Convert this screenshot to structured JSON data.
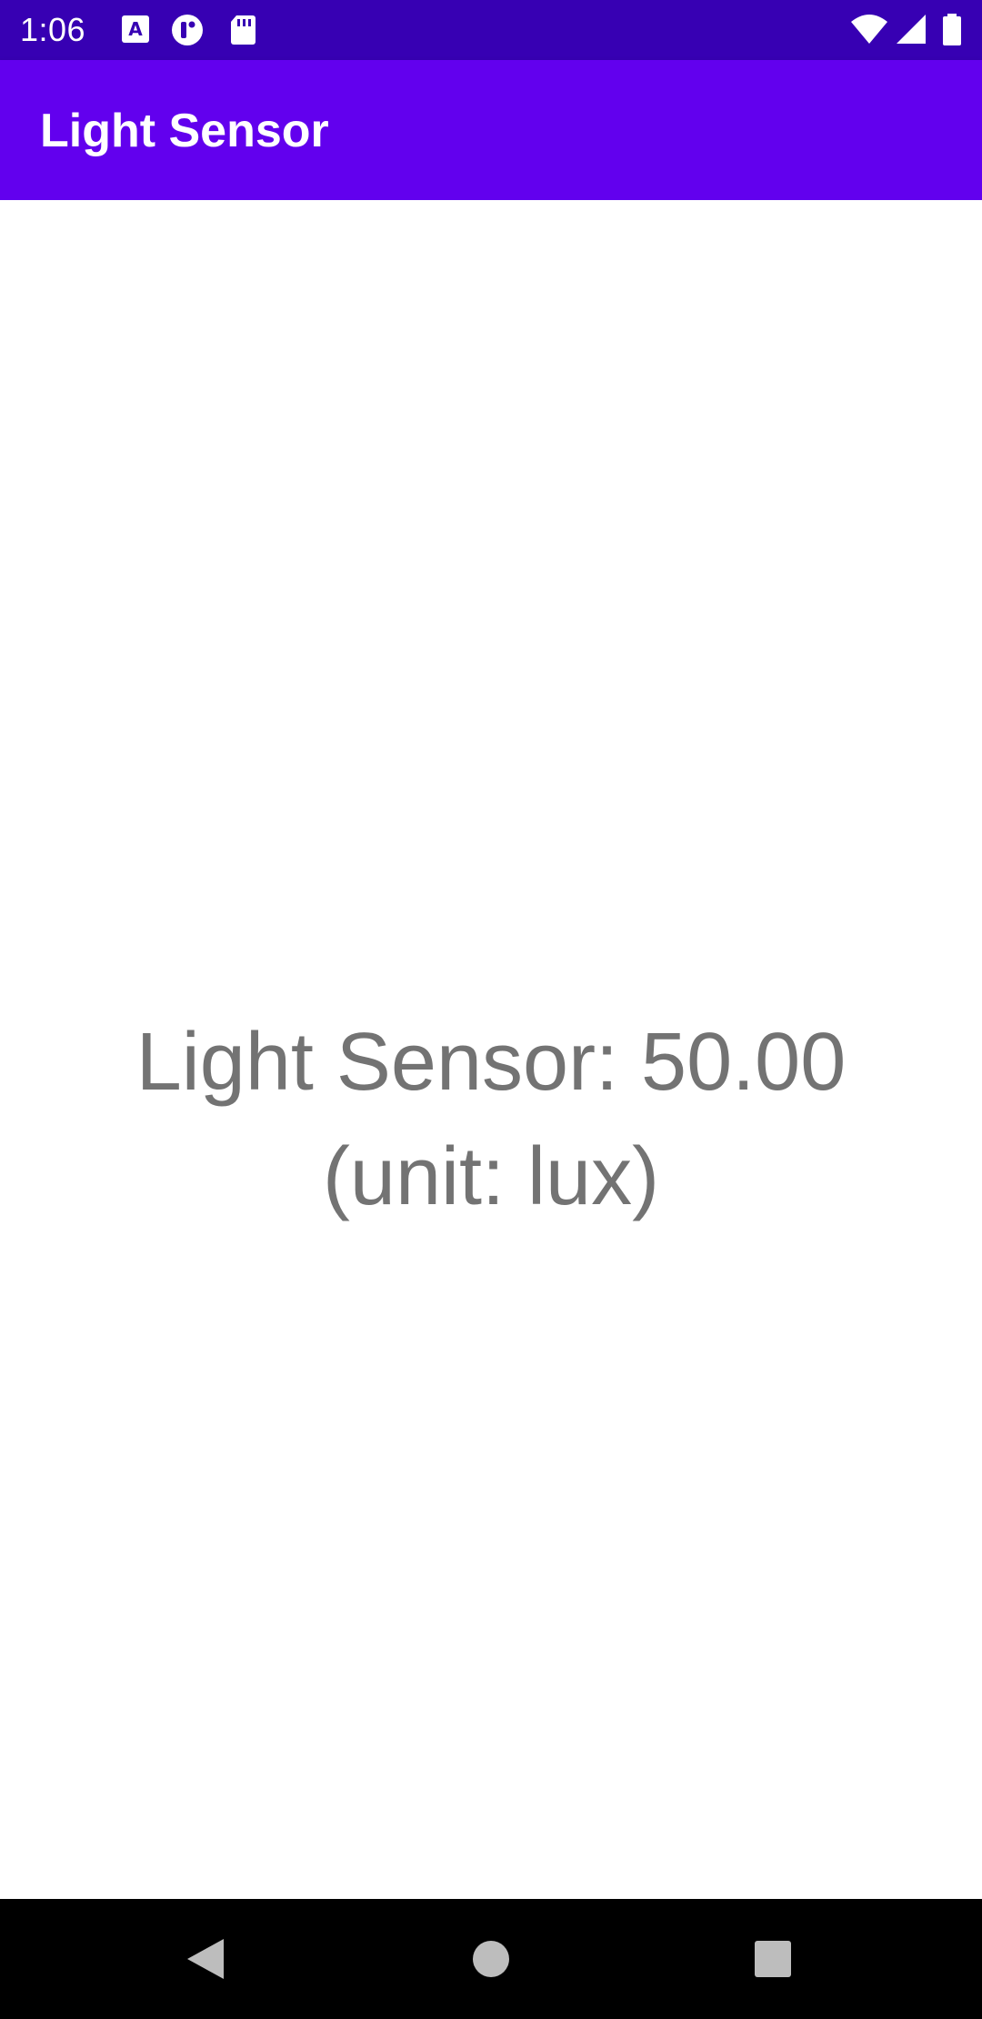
{
  "status_bar": {
    "time": "1:06",
    "background_color": "#3700b3",
    "left_icons": [
      "a-notification-icon",
      "circle-notification-icon",
      "sd-card-icon"
    ],
    "right_icons": [
      "wifi-icon",
      "signal-icon",
      "battery-icon"
    ]
  },
  "app_bar": {
    "title": "Light Sensor",
    "background_color": "#6200ee"
  },
  "main": {
    "sensor_line1": "Light Sensor: 50.00",
    "sensor_line2": "(unit: lux)",
    "text_color": "#737373"
  },
  "nav_bar": {
    "buttons": [
      "back-icon",
      "home-icon",
      "recents-icon"
    ]
  }
}
